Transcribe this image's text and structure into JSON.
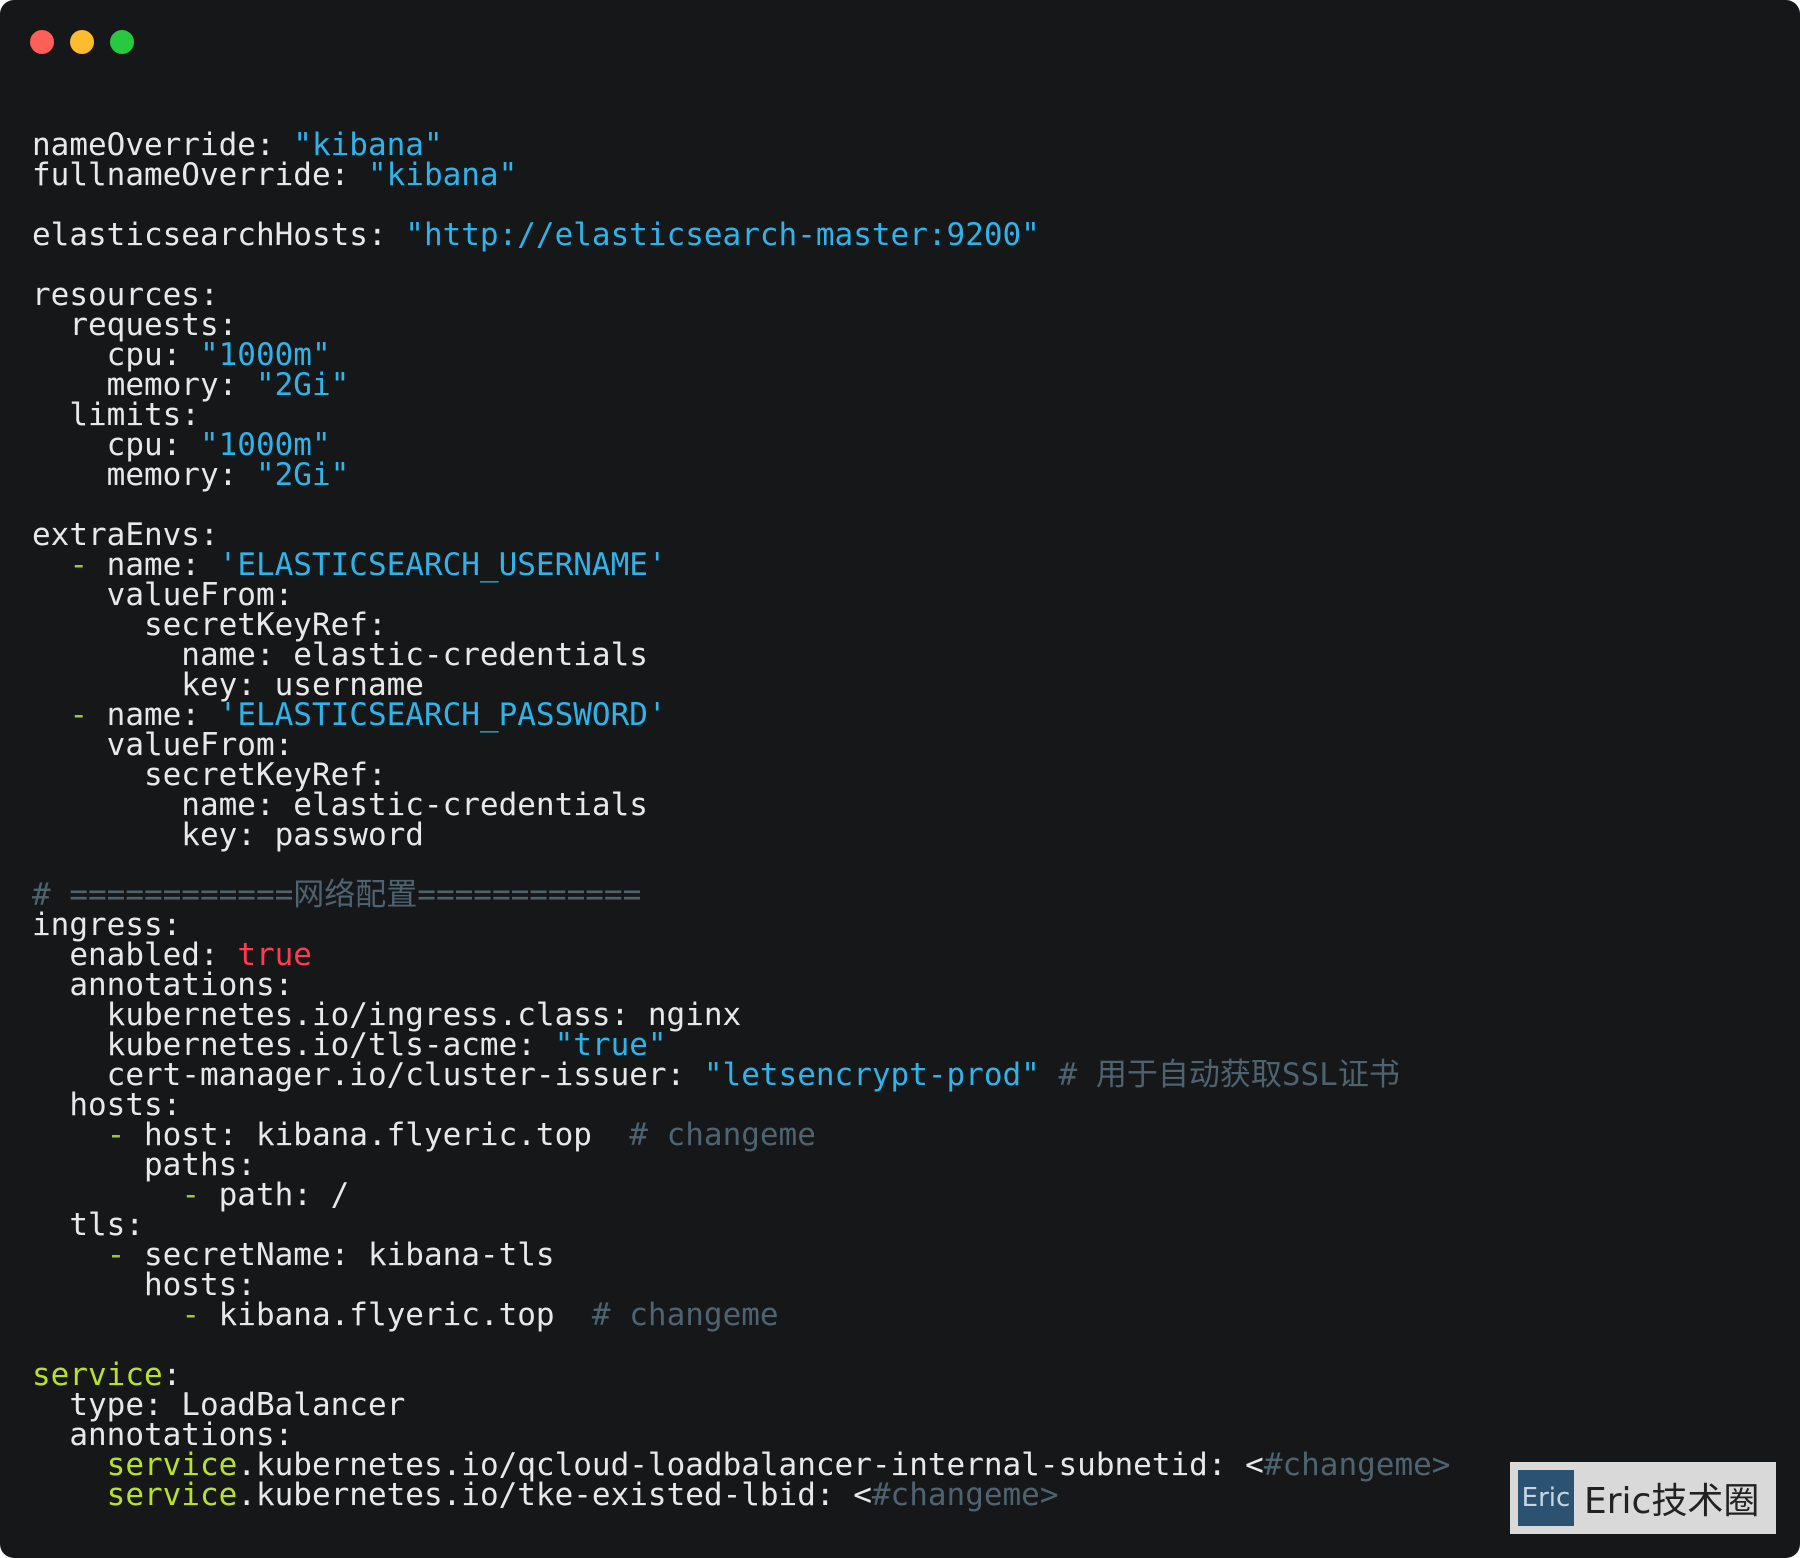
{
  "window": {
    "traffic_lights": {
      "close_color": "#fe5f57",
      "minimize_color": "#febb2e",
      "zoom_color": "#28c840"
    }
  },
  "code_lines": [
    [
      {
        "t": "nameOverride: "
      },
      {
        "t": "\"kibana\"",
        "c": "s"
      }
    ],
    [
      {
        "t": "fullnameOverride: "
      },
      {
        "t": "\"kibana\"",
        "c": "s"
      }
    ],
    [],
    [
      {
        "t": "elasticsearchHosts: "
      },
      {
        "t": "\"http://elasticsearch-master:9200\"",
        "c": "s"
      }
    ],
    [],
    [
      {
        "t": "resources:"
      }
    ],
    [
      {
        "t": "  requests:"
      }
    ],
    [
      {
        "t": "    cpu: "
      },
      {
        "t": "\"1000m\"",
        "c": "s"
      }
    ],
    [
      {
        "t": "    memory: "
      },
      {
        "t": "\"2Gi\"",
        "c": "s"
      }
    ],
    [
      {
        "t": "  limits:"
      }
    ],
    [
      {
        "t": "    cpu: "
      },
      {
        "t": "\"1000m\"",
        "c": "s"
      }
    ],
    [
      {
        "t": "    memory: "
      },
      {
        "t": "\"2Gi\"",
        "c": "s"
      }
    ],
    [],
    [
      {
        "t": "extraEnvs:"
      }
    ],
    [
      {
        "t": "  "
      },
      {
        "t": "-",
        "c": "d"
      },
      {
        "t": " name: "
      },
      {
        "t": "'ELASTICSEARCH_USERNAME'",
        "c": "s"
      }
    ],
    [
      {
        "t": "    valueFrom:"
      }
    ],
    [
      {
        "t": "      secretKeyRef:"
      }
    ],
    [
      {
        "t": "        name: elastic-credentials"
      }
    ],
    [
      {
        "t": "        key: username"
      }
    ],
    [
      {
        "t": "  "
      },
      {
        "t": "-",
        "c": "d"
      },
      {
        "t": " name: "
      },
      {
        "t": "'ELASTICSEARCH_PASSWORD'",
        "c": "s"
      }
    ],
    [
      {
        "t": "    valueFrom:"
      }
    ],
    [
      {
        "t": "      secretKeyRef:"
      }
    ],
    [
      {
        "t": "        name: elastic-credentials"
      }
    ],
    [
      {
        "t": "        key: password"
      }
    ],
    [],
    [
      {
        "t": "# ============网络配置============",
        "c": "c"
      }
    ],
    [
      {
        "t": "ingress:"
      }
    ],
    [
      {
        "t": "  enabled: "
      },
      {
        "t": "true",
        "c": "b"
      }
    ],
    [
      {
        "t": "  annotations:"
      }
    ],
    [
      {
        "t": "    kubernetes.io/ingress.class: nginx"
      }
    ],
    [
      {
        "t": "    kubernetes.io/tls-acme: "
      },
      {
        "t": "\"true\"",
        "c": "s"
      }
    ],
    [
      {
        "t": "    cert-manager.io/cluster-issuer: "
      },
      {
        "t": "\"letsencrypt-prod\"",
        "c": "s"
      },
      {
        "t": " # 用于自动获取SSL证书",
        "c": "c"
      }
    ],
    [
      {
        "t": "  hosts:"
      }
    ],
    [
      {
        "t": "    "
      },
      {
        "t": "-",
        "c": "d"
      },
      {
        "t": " host: kibana.flyeric.top  "
      },
      {
        "t": "# changeme",
        "c": "c"
      }
    ],
    [
      {
        "t": "      paths:"
      }
    ],
    [
      {
        "t": "        "
      },
      {
        "t": "-",
        "c": "d"
      },
      {
        "t": " path: /"
      }
    ],
    [
      {
        "t": "  tls:"
      }
    ],
    [
      {
        "t": "    "
      },
      {
        "t": "-",
        "c": "d"
      },
      {
        "t": " secretName: kibana-tls"
      }
    ],
    [
      {
        "t": "      hosts:"
      }
    ],
    [
      {
        "t": "        "
      },
      {
        "t": "-",
        "c": "d"
      },
      {
        "t": " kibana.flyeric.top  "
      },
      {
        "t": "# changeme",
        "c": "c"
      }
    ],
    [],
    [
      {
        "t": "service",
        "c": "y"
      },
      {
        "t": ":"
      }
    ],
    [
      {
        "t": "  type: LoadBalancer"
      }
    ],
    [
      {
        "t": "  annotations:"
      }
    ],
    [
      {
        "t": "    "
      },
      {
        "t": "service",
        "c": "y"
      },
      {
        "t": ".kubernetes.io/qcloud-loadbalancer-internal-subnetid: <"
      },
      {
        "t": "#changeme>",
        "c": "c"
      }
    ],
    [
      {
        "t": "    "
      },
      {
        "t": "service",
        "c": "y"
      },
      {
        "t": ".kubernetes.io/tke-existed-lbid: <"
      },
      {
        "t": "#changeme>",
        "c": "c"
      }
    ]
  ],
  "watermark": {
    "logo_text": "Eric",
    "label": "Eric技术圈"
  }
}
